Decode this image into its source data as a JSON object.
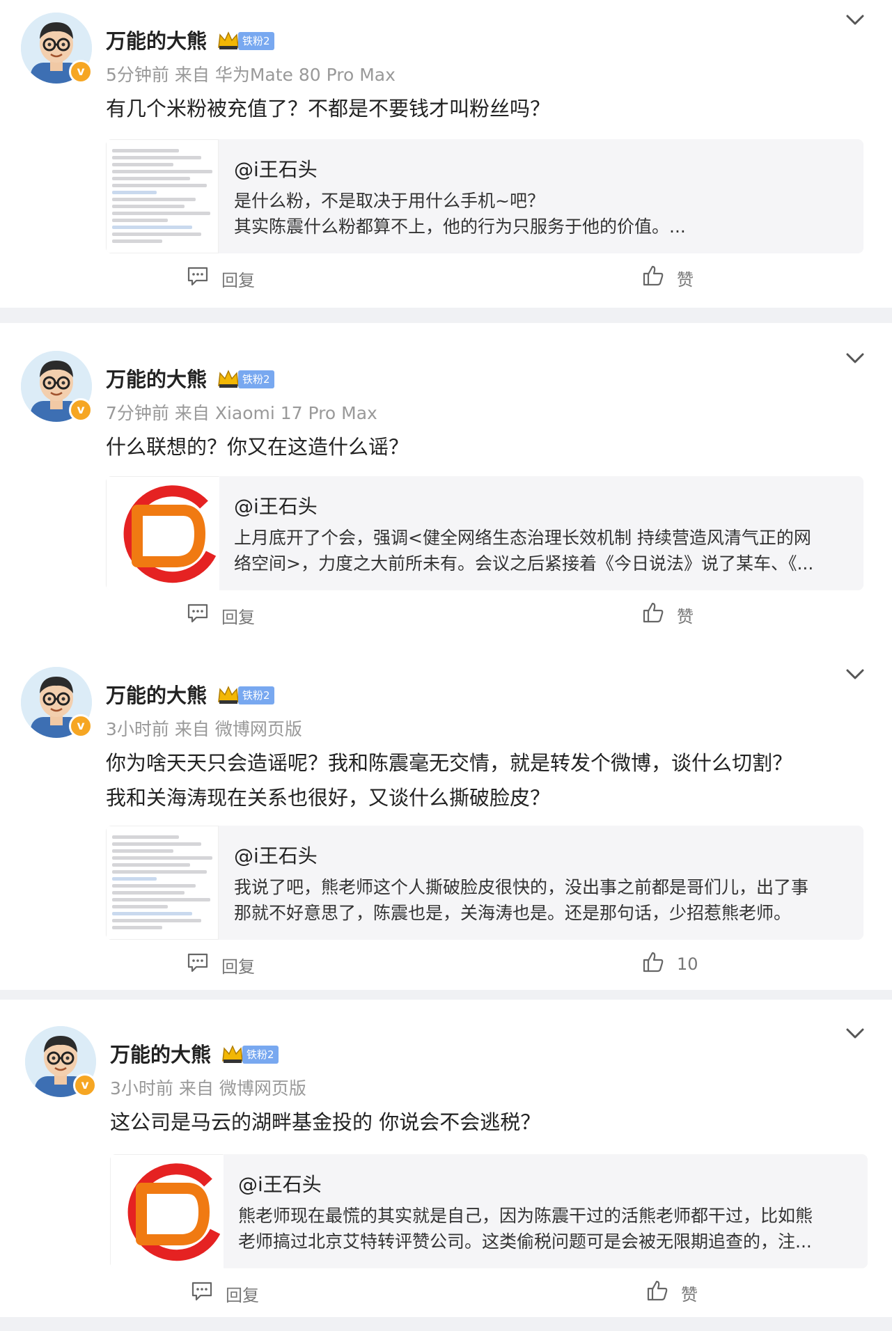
{
  "posts": [
    {
      "username": "万能的大熊",
      "fan_badge": "铁粉2",
      "time": "5分钟前",
      "source": "来自 华为Mate 80 Pro Max",
      "text_lines": [
        "有几个米粉被充值了？不都是不要钱才叫粉丝吗？"
      ],
      "card": {
        "author": "@i王石头",
        "excerpt_lines": [
          "是什么粉，不是取决于用什么手机~吧？",
          "其实陈震什么粉都算不上，他的行为只服务于他的价值。..."
        ],
        "thumb": "screenshot"
      },
      "reply_label": "回复",
      "like_label": "赞"
    },
    {
      "username": "万能的大熊",
      "fan_badge": "铁粉2",
      "time": "7分钟前",
      "source": "来自 Xiaomi 17 Pro Max",
      "text_lines": [
        "什么联想的？你又在这造什么谣？"
      ],
      "card": {
        "author": "@i王石头",
        "excerpt_lines": [
          "上月底开了个会，强调<健全网络生态治理长效机制 持续营造风清气正的网",
          "络空间>，力度之大前所未有。会议之后紧接着《今日说法》说了某车、《..."
        ],
        "thumb": "logo"
      },
      "reply_label": "回复",
      "like_label": "赞"
    },
    {
      "username": "万能的大熊",
      "fan_badge": "铁粉2",
      "time": "3小时前",
      "source": "来自 微博网页版",
      "text_lines": [
        "你为啥天天只会造谣呢？我和陈震毫无交情，就是转发个微博，谈什么切割？",
        "我和关海涛现在关系也很好，又谈什么撕破脸皮？"
      ],
      "card": {
        "author": "@i王石头",
        "excerpt_lines": [
          "我说了吧，熊老师这个人撕破脸皮很快的，没出事之前都是哥们儿，出了事",
          "那就不好意思了，陈震也是，关海涛也是。还是那句话，少招惹熊老师。"
        ],
        "thumb": "screenshot"
      },
      "reply_label": "回复",
      "like_label": "10"
    },
    {
      "username": "万能的大熊",
      "fan_badge": "铁粉2",
      "time": "3小时前",
      "source": "来自 微博网页版",
      "text_lines": [
        "这公司是马云的湖畔基金投的 你说会不会逃税？"
      ],
      "card": {
        "author": "@i王石头",
        "excerpt_lines": [
          "熊老师现在最慌的其实就是自己，因为陈震干过的活熊老师都干过，比如熊",
          "老师搞过北京艾特转评赞公司。这类偷税问题可是会被无限期追查的，注..."
        ],
        "thumb": "logo"
      },
      "reply_label": "回复",
      "like_label": "赞"
    }
  ],
  "colors": {
    "separator": "#f0f1f4",
    "card_bg": "#f5f5f7",
    "verified": "#f6a623",
    "fan_badge": "#78a8f0",
    "meta": "#999999"
  }
}
